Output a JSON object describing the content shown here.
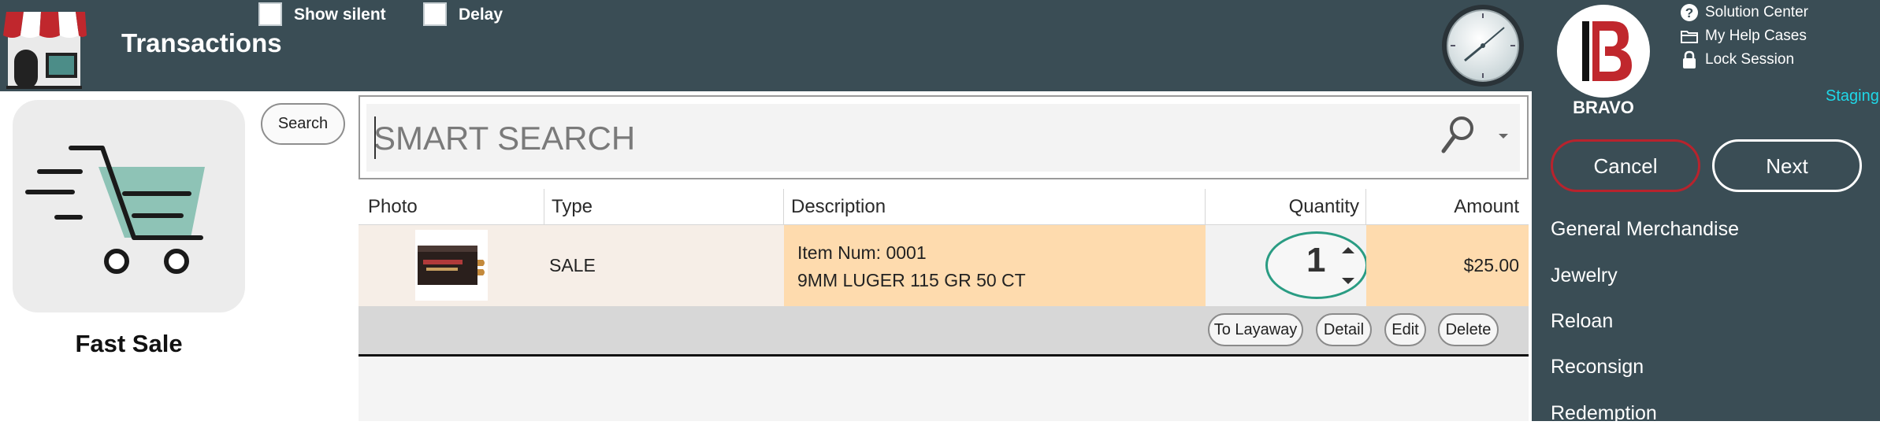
{
  "header": {
    "title": "Transactions",
    "store_icon": "storefront-icon",
    "show_silent_label": "Show silent",
    "delay_label": "Delay",
    "clock_icon": "clock-icon"
  },
  "brand": {
    "logo_label": "BRAVO",
    "links": [
      {
        "icon": "question-icon",
        "label": "Solution Center"
      },
      {
        "icon": "folder-icon",
        "label": "My Help Cases"
      },
      {
        "icon": "lock-icon",
        "label": "Lock Session"
      }
    ],
    "environment": "Staging"
  },
  "actions": {
    "cancel_label": "Cancel",
    "next_label": "Next"
  },
  "menu": {
    "items": [
      {
        "label": "General Merchandise"
      },
      {
        "label": "Jewelry"
      },
      {
        "label": "Reloan"
      },
      {
        "label": "Reconsign"
      },
      {
        "label": "Redemption"
      }
    ]
  },
  "tile": {
    "label": "Fast Sale",
    "icon": "shopping-cart-icon"
  },
  "search": {
    "button_label": "Search",
    "placeholder": "SMART SEARCH",
    "value": ""
  },
  "table": {
    "columns": [
      "Photo",
      "Type",
      "Description",
      "Quantity",
      "Amount"
    ],
    "rows": [
      {
        "photo_icon": "ammo-box-image",
        "type": "SALE",
        "description_line1": "Item Num: 0001",
        "description_line2": "9MM LUGER 115 GR 50 CT",
        "quantity": "1",
        "amount": "$25.00"
      }
    ],
    "row_actions": [
      "To Layaway",
      "Detail",
      "Edit",
      "Delete"
    ]
  },
  "colors": {
    "header_bg": "#3a4d55",
    "row_highlight": "#fedbae",
    "cancel_border": "#b8232d",
    "staging_text": "#1fd8e8",
    "quantity_ring": "#2a9c83"
  }
}
